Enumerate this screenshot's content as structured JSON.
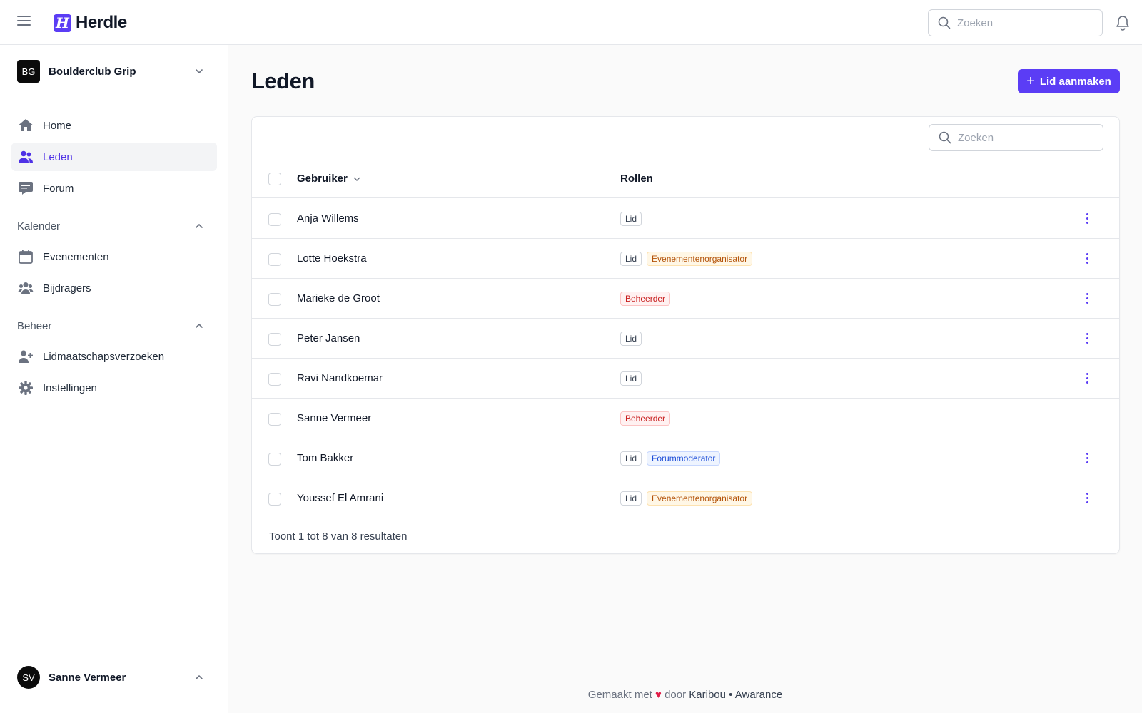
{
  "app": {
    "name": "Herdle",
    "logo_letter": "H"
  },
  "header": {
    "search_placeholder": "Zoeken"
  },
  "sidebar": {
    "org": {
      "initials": "BG",
      "name": "Boulderclub Grip"
    },
    "items": [
      {
        "label": "Home",
        "icon": "home-icon"
      },
      {
        "label": "Leden",
        "icon": "users-icon",
        "active": true
      },
      {
        "label": "Forum",
        "icon": "chat-icon"
      }
    ],
    "sections": [
      {
        "title": "Kalender",
        "items": [
          {
            "label": "Evenementen",
            "icon": "calendar-icon"
          },
          {
            "label": "Bijdragers",
            "icon": "user-group-icon"
          }
        ]
      },
      {
        "title": "Beheer",
        "items": [
          {
            "label": "Lidmaatschapsverzoeken",
            "icon": "user-plus-icon"
          },
          {
            "label": "Instellingen",
            "icon": "gear-icon"
          }
        ]
      }
    ],
    "user": {
      "initials": "SV",
      "name": "Sanne Vermeer"
    }
  },
  "main": {
    "title": "Leden",
    "create_button": "Lid aanmaken",
    "search_placeholder": "Zoeken",
    "columns": {
      "user": "Gebruiker",
      "roles": "Rollen"
    },
    "rows": [
      {
        "name": "Anja Willems",
        "roles": [
          "Lid"
        ]
      },
      {
        "name": "Lotte Hoekstra",
        "roles": [
          "Lid",
          "Evenementenorganisator"
        ]
      },
      {
        "name": "Marieke de Groot",
        "roles": [
          "Beheerder"
        ]
      },
      {
        "name": "Peter Jansen",
        "roles": [
          "Lid"
        ]
      },
      {
        "name": "Ravi Nandkoemar",
        "roles": [
          "Lid"
        ]
      },
      {
        "name": "Sanne Vermeer",
        "roles": [
          "Beheerder"
        ],
        "no_actions": true
      },
      {
        "name": "Tom Bakker",
        "roles": [
          "Lid",
          "Forummoderator"
        ]
      },
      {
        "name": "Youssef El Amrani",
        "roles": [
          "Lid",
          "Evenementenorganisator"
        ]
      }
    ],
    "results_text": "Toont 1 tot 8 van 8 resultaten"
  },
  "footer": {
    "made_with": "Gemaakt met",
    "heart": "♥",
    "by": "door",
    "author1": "Karibou",
    "separator": "•",
    "author2": "Awarance"
  },
  "colors": {
    "accent": "#5b3df5",
    "role_member": "#374151",
    "role_event_organizer": "#b45309",
    "role_admin": "#c81e1e",
    "role_moderator": "#1d4ed8"
  }
}
